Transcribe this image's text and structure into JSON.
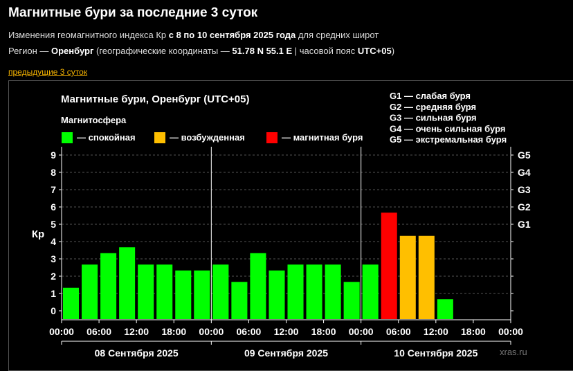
{
  "header": {
    "title": "Магнитные бури за последние 3 суток",
    "line1_a": "Изменения геомагнитного индекса Кр ",
    "line1_b": "с 8 по 10 сентября 2025 года",
    "line1_c": " для средних широт",
    "line2_a": "Регион — ",
    "line2_b": "Оренбург",
    "line2_c": " (географические координаты — ",
    "line2_d": "51.78 N 55.1 E",
    "line2_e": " | часовой пояс ",
    "line2_f": "UTC+05",
    "line2_g": ")",
    "prev_link": "предыдущие 3 суток"
  },
  "chart_data": {
    "type": "bar",
    "title": "Магнитные бури, Оренбург (UTC+05)",
    "ylabel": "Кр",
    "ylim": [
      0,
      9
    ],
    "yticks": [
      "0",
      "1",
      "2",
      "3",
      "4",
      "5",
      "6",
      "7",
      "8",
      "9"
    ],
    "g_scale": [
      {
        "level": 5,
        "label": "G1"
      },
      {
        "level": 6,
        "label": "G2"
      },
      {
        "level": 7,
        "label": "G3"
      },
      {
        "level": 8,
        "label": "G4"
      },
      {
        "level": 9,
        "label": "G5"
      }
    ],
    "g_legend": [
      "G1 — слабая буря",
      "G2 — средняя буря",
      "G3 — сильная буря",
      "G4 — очень сильная буря",
      "G5 — экстремальная буря"
    ],
    "legend_title": "Магнитосфера",
    "legend": [
      {
        "label": "— спокойная",
        "color": "#00ff00"
      },
      {
        "label": "— возбужденная",
        "color": "#ffbf00"
      },
      {
        "label": "— магнитная буря",
        "color": "#ff0000"
      }
    ],
    "colors": {
      "quiet": "#00ff00",
      "active": "#ffbf00",
      "storm": "#ff0000"
    },
    "xticks": [
      "00:00",
      "06:00",
      "12:00",
      "18:00",
      "00:00",
      "06:00",
      "12:00",
      "18:00",
      "00:00",
      "06:00",
      "12:00",
      "18:00",
      "00:00"
    ],
    "days": [
      "08 Сентября 2025",
      "09 Сентября 2025",
      "10 Сентября 2025"
    ],
    "intervals_per_day": 8,
    "values": [
      1.33,
      2.67,
      3.33,
      3.67,
      2.67,
      2.67,
      2.33,
      2.33,
      2.67,
      1.67,
      3.33,
      2.33,
      2.67,
      2.67,
      2.67,
      1.67,
      2.67,
      5.67,
      4.33,
      4.33,
      0.67
    ],
    "grid": true
  },
  "watermark": "xras.ru"
}
